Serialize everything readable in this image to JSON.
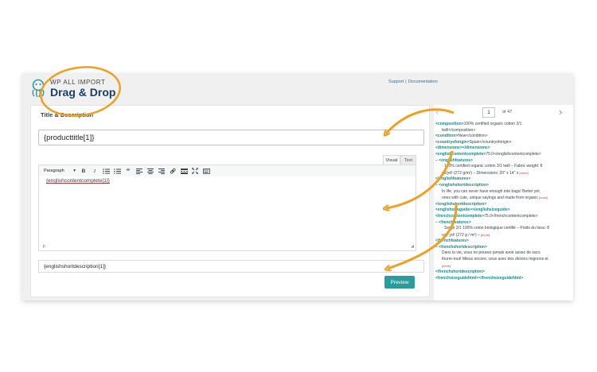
{
  "brand": {
    "top": "WP ALL IMPORT",
    "main": "Drag & Drop"
  },
  "links": {
    "support": "Support",
    "sep": "|",
    "docs": "Documentation"
  },
  "panel": {
    "title": "Title & Description",
    "title_value": "{producttitle[1]}",
    "tabs": {
      "visual": "Visual",
      "text": "Text"
    },
    "toolbar": {
      "paragraph": "Paragraph",
      "bold": "B",
      "italic": "I",
      "quote": "“"
    },
    "content": "{englishcontentcomplete[1]}",
    "path": "p",
    "short_description": "{englishshortdescription[1]}",
    "preview": "Preview"
  },
  "pager": {
    "current": "1",
    "of": "of 47"
  },
  "xml_lines": [
    {
      "t": "<composition>",
      "v": "100% certified organic cotton 3/1"
    },
    {
      "t": "",
      "v": "twill</composition>"
    },
    {
      "t": "<condition>",
      "v": "New</condition>"
    },
    {
      "t": "<countryoforigin>",
      "v": "Spain</countryoforigin>"
    },
    {
      "t": "<dimensions></dimensions>",
      "v": ""
    },
    {
      "t": "<englishcontentcomplete>",
      "v": "75.0</englishcontentcomplete>"
    },
    {
      "t": "– <englishfeatures>",
      "v": ""
    },
    {
      "t": "",
      "v": "· 100% certified organic cotton 3/1 twill – Fabric weight: 8"
    },
    {
      "t": "",
      "v": "oz/yd² (272 g/m²) – Dimensions: 20\" x 14\" x",
      "m": "[more]"
    },
    {
      "t": "</englishfeatures>",
      "v": ""
    },
    {
      "t": "– <englishshortdescription>",
      "v": ""
    },
    {
      "t": "",
      "v": "In life, you can never have enough tote bags! Better yet,"
    },
    {
      "t": "",
      "v": "ones with cute, unique sayings and made from organic",
      "m": "[more]"
    },
    {
      "t": "</englishshortdescription>",
      "v": ""
    },
    {
      "t": "<englishsizeguide></englishsizeguide>",
      "v": ""
    },
    {
      "t": "<frenchcontentcomplete>",
      "v": "75.0</frenchcontentcomplete>"
    },
    {
      "t": "– <frenchfeatures>",
      "v": ""
    },
    {
      "t": "",
      "v": "· Sergé 3/1 100% coton biologique certifié – Poids du tissu: 8"
    },
    {
      "t": "",
      "v": "oz / yd² (272 g / m²) –",
      "m": "[more]"
    },
    {
      "t": "</frenchfeatures>",
      "v": ""
    },
    {
      "t": "– <frenchshortdescription>",
      "v": ""
    },
    {
      "t": "",
      "v": "Dans la vie, vous ne pouvez jamais avoir assez de sacs"
    },
    {
      "t": "",
      "v": "fourre-tout! Mieux encore, ceux avec des dictons mignons et"
    },
    {
      "t": "",
      "v": "",
      "m": "[more]"
    },
    {
      "t": "</frenchshortdescription>",
      "v": ""
    },
    {
      "t": "<frenchsizeguidehtml></frenchsizeguidehtml>",
      "v": ""
    }
  ],
  "colors": {
    "accent": "#2b9c9c",
    "tag": "#1a8787",
    "annotation": "#f0a01e",
    "brand": "#1c3e66"
  }
}
